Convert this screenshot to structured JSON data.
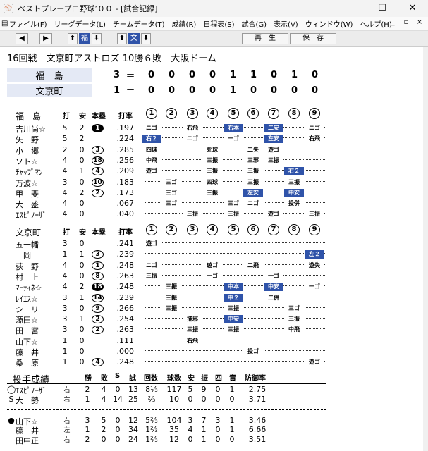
{
  "window": {
    "title": "ベストプレープロ野球’００ - [試合記録]",
    "min": "—",
    "max": "☐",
    "close": "✕"
  },
  "menu": [
    "ファイル(F)",
    "リーグデータ(L)",
    "チームデータ(T)",
    "成績(R)",
    "日程表(S)",
    "試合(G)",
    "表示(V)",
    "ウィンドウ(W)",
    "ヘルプ(H)"
  ],
  "mdi": {
    "min": "_",
    "restore": "▫",
    "close": "×"
  },
  "toolbar": {
    "left": "◀",
    "right": "▶",
    "up1": "⬆",
    "fuku": "福",
    "down1": "⬇",
    "up2": "⬆",
    "bun": "文",
    "down2": "⬇",
    "play": "再　生",
    "save": "保　存"
  },
  "game": {
    "title": "16回戦　文京町アストロズ 10勝６敗　大阪ドーム"
  },
  "linescore": [
    {
      "team": "福　島",
      "runs": "3",
      "eq": "＝",
      "innings": [
        "0",
        "0",
        "0",
        "0",
        "1",
        "1",
        "0",
        "1",
        "0"
      ]
    },
    {
      "team": "文京町",
      "runs": "1",
      "eq": "＝",
      "innings": [
        "0",
        "0",
        "0",
        "0",
        "1",
        "0",
        "0",
        "0",
        "0"
      ]
    }
  ],
  "batting_headers": {
    "ab": "打",
    "h": "安",
    "hr": "本塁",
    "avg": "打率"
  },
  "innings_labels": [
    "1",
    "2",
    "3",
    "4",
    "5",
    "6",
    "7",
    "8",
    "9"
  ],
  "team1": {
    "name": "福　島",
    "players": [
      {
        "name": "吉川尚☆",
        "ab": "5",
        "h": "2",
        "hr": "1",
        "hrfill": true,
        "avg": ".197"
      },
      {
        "name": "矢　野",
        "ab": "5",
        "h": "2",
        "hr": "",
        "avg": ".224"
      },
      {
        "name": "小　郷",
        "ab": "2",
        "h": "0",
        "hr": "3",
        "avg": ".285"
      },
      {
        "name": "ソト☆",
        "ab": "4",
        "h": "0",
        "hr": "18",
        "avg": ".256"
      },
      {
        "name": "ﾁｬｯﾌﾟﾏﾝ",
        "ab": "4",
        "h": "1",
        "hr": "4",
        "avg": ".209"
      },
      {
        "name": "万波☆",
        "ab": "3",
        "h": "0",
        "hr": "10",
        "avg": ".183"
      },
      {
        "name": "甲　斐",
        "ab": "4",
        "h": "2",
        "hr": "2",
        "avg": ".173"
      },
      {
        "name": "大　盛",
        "ab": "4",
        "h": "0",
        "hr": "",
        "avg": ".067"
      },
      {
        "name": "ｴｽﾋﾟﾉｰｻﾞ",
        "ab": "4",
        "h": "0",
        "hr": "",
        "avg": ".040"
      }
    ]
  },
  "team2": {
    "name": "文京町",
    "players": [
      {
        "name": "五十幡",
        "ab": "3",
        "h": "0",
        "hr": "",
        "avg": ".241"
      },
      {
        "name": "　岡",
        "ab": "1",
        "h": "1",
        "hr": "3",
        "avg": ".239"
      },
      {
        "name": "荻　野",
        "ab": "4",
        "h": "0",
        "hr": "1",
        "avg": ".248"
      },
      {
        "name": "村　上",
        "ab": "4",
        "h": "0",
        "hr": "8",
        "avg": ".263"
      },
      {
        "name": "ﾏｰﾃｨﾈ☆",
        "ab": "4",
        "h": "2",
        "hr": "18",
        "hrfill": true,
        "avg": ".248"
      },
      {
        "name": "ﾚｲｴｽ☆",
        "ab": "3",
        "h": "1",
        "hr": "14",
        "avg": ".239"
      },
      {
        "name": "シ　リ",
        "ab": "3",
        "h": "0",
        "hr": "9",
        "avg": ".266"
      },
      {
        "name": "源田☆",
        "ab": "3",
        "h": "1",
        "hr": "2",
        "avg": ".254"
      },
      {
        "name": "田　宮",
        "ab": "3",
        "h": "0",
        "hr": "2",
        "avg": ".263"
      },
      {
        "name": "山下☆",
        "ab": "1",
        "h": "0",
        "hr": "",
        "avg": ".111"
      },
      {
        "name": "藤　井",
        "ab": "1",
        "h": "0",
        "hr": "",
        "avg": ".000"
      },
      {
        "name": "桑　原",
        "ab": "1",
        "h": "0",
        "hr": "4",
        "avg": ".248"
      }
    ]
  },
  "pitching": {
    "title": "投手成績",
    "headers": [
      "勝",
      "敗",
      "S",
      "試",
      "回数",
      "球数",
      "安",
      "振",
      "四",
      "責",
      "防御率"
    ],
    "rows": [
      {
        "mark": "◯",
        "name": "ｴｽﾋﾟﾉｰｻﾞ",
        "hand": "右",
        "w": "2",
        "l": "4",
        "s": "0",
        "g": "13",
        "ip": "8⅓",
        "np": "117",
        "h": "5",
        "k": "9",
        "bb": "0",
        "er": "1",
        "era": "2.75"
      },
      {
        "mark": "S",
        "name": "大　勢",
        "hand": "右",
        "w": "1",
        "l": "4",
        "s": "14",
        "g": "25",
        "ip": "⅔",
        "np": "10",
        "h": "0",
        "k": "0",
        "bb": "0",
        "er": "0",
        "era": "3.71"
      },
      {
        "mark": "●",
        "name": "山下☆",
        "hand": "右",
        "w": "3",
        "l": "5",
        "s": "0",
        "g": "12",
        "ip": "5⅔",
        "np": "104",
        "h": "3",
        "k": "7",
        "bb": "3",
        "er": "1",
        "era": "3.46"
      },
      {
        "mark": "",
        "name": "藤　井",
        "hand": "左",
        "w": "1",
        "l": "2",
        "s": "0",
        "g": "34",
        "ip": "1⅔",
        "np": "35",
        "h": "4",
        "k": "1",
        "bb": "0",
        "er": "1",
        "era": "6.66"
      },
      {
        "mark": "",
        "name": "田中正",
        "hand": "右",
        "w": "2",
        "l": "0",
        "s": "0",
        "g": "24",
        "ip": "1⅔",
        "np": "12",
        "h": "0",
        "k": "1",
        "bb": "0",
        "er": "0",
        "era": "3.51"
      }
    ]
  },
  "colors": {
    "hit": "#2f53a9",
    "header_bg": "#e4e9f5"
  }
}
